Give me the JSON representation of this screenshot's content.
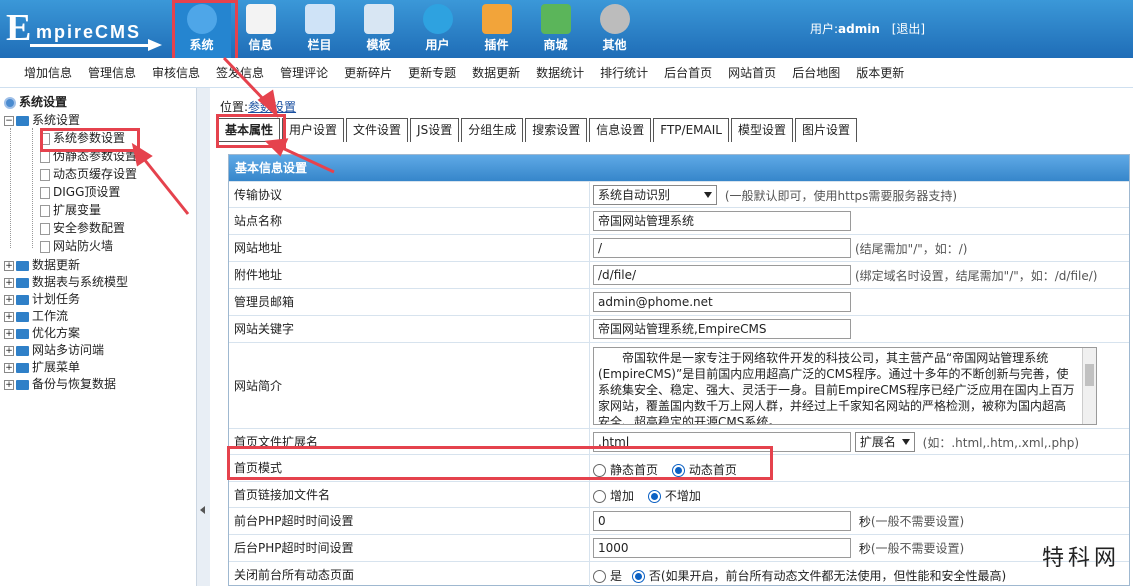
{
  "logo": {
    "big": "E",
    "rest": "mpireCMS"
  },
  "nav": [
    {
      "label": "系统",
      "icon": "globe-icon",
      "color": "#4ea6e8",
      "active": true
    },
    {
      "label": "信息",
      "icon": "edit-note-icon",
      "color": "#f3f3f3"
    },
    {
      "label": "栏目",
      "icon": "folder-icon",
      "color": "#cfe3f7"
    },
    {
      "label": "模板",
      "icon": "window-icon",
      "color": "#d8e6f3"
    },
    {
      "label": "用户",
      "icon": "user-icon",
      "color": "#2ea2e0"
    },
    {
      "label": "插件",
      "icon": "tools-icon",
      "color": "#f2a43a"
    },
    {
      "label": "商城",
      "icon": "card-icon",
      "color": "#5bb55a"
    },
    {
      "label": "其他",
      "icon": "gear-icon",
      "color": "#bcbcbc"
    }
  ],
  "user": {
    "prefix": "用户:",
    "name": "admin",
    "logout": "[退出]"
  },
  "submenu": [
    "增加信息",
    "管理信息",
    "审核信息",
    "签发信息",
    "管理评论",
    "更新碎片",
    "更新专题",
    "数据更新",
    "数据统计",
    "排行统计",
    "后台首页",
    "网站首页",
    "后台地图",
    "版本更新"
  ],
  "sidebar": {
    "root": "系统设置",
    "group": "系统设置",
    "children": [
      "系统参数设置",
      "伪静态参数设置",
      "动态页缓存设置",
      "DIGG顶设置",
      "扩展变量",
      "安全参数配置",
      "网站防火墙"
    ],
    "folders": [
      "数据更新",
      "数据表与系统模型",
      "计划任务",
      "工作流",
      "优化方案",
      "网站多访问端",
      "扩展菜单",
      "备份与恢复数据"
    ]
  },
  "location": {
    "prefix": "位置:",
    "link": "参数设置"
  },
  "tabs": [
    "基本属性",
    "用户设置",
    "文件设置",
    "JS设置",
    "分组生成",
    "搜索设置",
    "信息设置",
    "FTP/EMAIL",
    "模型设置",
    "图片设置"
  ],
  "form": {
    "header": "基本信息设置",
    "protocol": {
      "label": "传输协议",
      "value": "系统自动识别",
      "hint": "(一般默认即可，使用https需要服务器支持)"
    },
    "sitename": {
      "label": "站点名称",
      "value": "帝国网站管理系统"
    },
    "siteurl": {
      "label": "网站地址",
      "value": "/",
      "hint": "(结尾需加\"/\"，如：/)"
    },
    "fileurl": {
      "label": "附件地址",
      "value": "/d/file/",
      "hint": "(绑定域名时设置，结尾需加\"/\"，如：/d/file/)"
    },
    "email": {
      "label": "管理员邮箱",
      "value": "admin@phome.net"
    },
    "keywords": {
      "label": "网站关键字",
      "value": "帝国网站管理系统,EmpireCMS"
    },
    "intro": {
      "label": "网站简介",
      "value": "帝国软件是一家专注于网络软件开发的科技公司，其主营产品“帝国网站管理系统(EmpireCMS)”是目前国内应用超高广泛的CMS程序。通过十多年的不断创新与完善，使系统集安全、稳定、强大、灵活于一身。目前EmpireCMS程序已经广泛应用在国内上百万家网站，覆盖国内数千万上网人群，并经过上千家知名网站的严格检测，被称为国内超高安全、超高稳定的开源CMS系统。"
    },
    "ext": {
      "label": "首页文件扩展名",
      "value": ".html",
      "select": "扩展名",
      "hint": "(如：.html,.htm,.xml,.php)"
    },
    "mode": {
      "label": "首页模式",
      "opt1": "静态首页",
      "opt2": "动态首页"
    },
    "addfile": {
      "label": "首页链接加文件名",
      "opt1": "增加",
      "opt2": "不增加"
    },
    "fronttimeout": {
      "label": "前台PHP超时时间设置",
      "value": "0",
      "unit": "秒",
      "hint": "(一般不需要设置)"
    },
    "backtimeout": {
      "label": "后台PHP超时时间设置",
      "value": "1000",
      "unit": "秒",
      "hint": "(一般不需要设置)"
    },
    "closedyn": {
      "label": "关闭前台所有动态页面",
      "opt1": "是",
      "opt2": "否(如果开启，前台所有动态文件都无法使用，但性能和安全性最高)"
    }
  },
  "watermark": "特科网",
  "accent": "#e5424d"
}
